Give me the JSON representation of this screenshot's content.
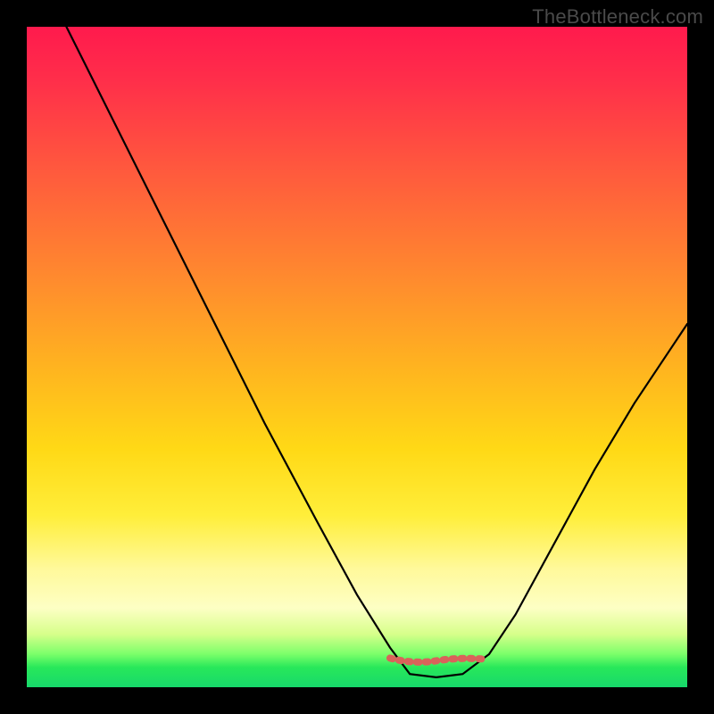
{
  "brand": "TheBottleneck.com",
  "colors": {
    "frame": "#000000",
    "gradient_top": "#ff1a4d",
    "gradient_mid1": "#ff8a2e",
    "gradient_mid2": "#ffee3a",
    "gradient_bottom": "#17d86b",
    "curve": "#000000",
    "marker": "#d9635a"
  },
  "chart_data": {
    "type": "line",
    "title": "",
    "xlabel": "",
    "ylabel": "",
    "xlim": [
      0,
      100
    ],
    "ylim": [
      0,
      100
    ],
    "grid": false,
    "legend": false,
    "annotations": [],
    "curve_note": "Single V-shaped curve; left branch starts near the top-left and descends to a flat minimum around x≈58–67 at y≈2, then right branch rises with moderate steepness toward the right edge at roughly y≈55.",
    "series": [
      {
        "name": "curve",
        "x": [
          6,
          12,
          20,
          28,
          36,
          44,
          50,
          55,
          58,
          62,
          66,
          70,
          74,
          80,
          86,
          92,
          98,
          100
        ],
        "y": [
          100,
          88,
          72,
          56,
          40,
          25,
          14,
          6,
          2,
          1.5,
          2,
          5,
          11,
          22,
          33,
          43,
          52,
          55
        ]
      }
    ],
    "markers": {
      "name": "min-band",
      "note": "Short salmon dashed band at the trough of the curve.",
      "x_start": 55,
      "x_end": 69,
      "y": 4
    }
  }
}
